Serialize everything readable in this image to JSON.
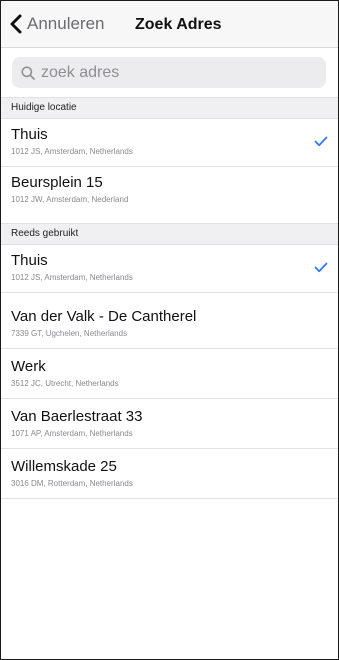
{
  "nav": {
    "back_label": "Annuleren",
    "title": "Zoek Adres"
  },
  "search": {
    "placeholder": "zoek adres",
    "value": ""
  },
  "colors": {
    "accent": "#2f7bf6",
    "nav_background": "#f7f7f8",
    "section_background": "#f0f0f2"
  },
  "sections": [
    {
      "header": "Huidige locatie",
      "items": [
        {
          "name": "Thuis",
          "address": "1012 JS, Amsterdam, Netherlands",
          "checked": true
        },
        {
          "name": "Beursplein 15",
          "address": "1012 JW, Amsterdam, Nederland",
          "checked": false
        }
      ]
    },
    {
      "header": "Reeds gebruikt",
      "items": [
        {
          "name": "Thuis",
          "address": "1012 JS, Amsterdam, Netherlands",
          "checked": true
        },
        {
          "name": "Van der Valk - De Cantherel",
          "address": "7339 GT, Ugchelen, Netherlands",
          "checked": false
        },
        {
          "name": "Werk",
          "address": "3512 JC, Utrecht, Netherlands",
          "checked": false
        },
        {
          "name": "Van Baerlestraat 33",
          "address": "1071 AP, Amsterdam, Netherlands",
          "checked": false
        },
        {
          "name": "Willemskade 25",
          "address": "3016 DM, Rotterdam, Netherlands",
          "checked": false
        }
      ]
    }
  ],
  "icons": {
    "back": "chevron-left-icon",
    "search": "search-icon",
    "check": "checkmark-icon"
  }
}
